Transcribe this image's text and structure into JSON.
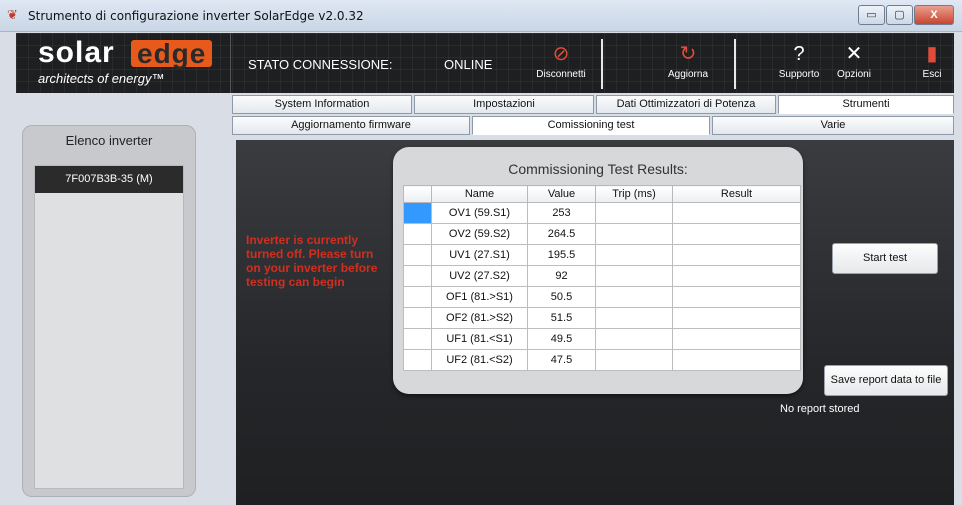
{
  "window": {
    "title": "Strumento di configurazione inverter SolarEdge v2.0.32",
    "controls": {
      "minimize": "▭",
      "maximize": "▢",
      "close": "X"
    }
  },
  "header": {
    "logo_solar": "solar",
    "logo_edge": "edge",
    "logo_tagline": "architects of energy™",
    "connection_label": "STATO CONNESSIONE:",
    "connection_status": "ONLINE",
    "buttons": [
      {
        "label": "Disconnetti",
        "icon": "unlink-icon"
      },
      {
        "label": "Aggiorna",
        "icon": "refresh-icon"
      },
      {
        "label": "Supporto",
        "icon": "help-icon"
      },
      {
        "label": "Opzioni",
        "icon": "tools-icon"
      },
      {
        "label": "Esci",
        "icon": "exit-door-icon"
      }
    ],
    "colors": {
      "background": "#1e1f21",
      "accent": "#e85a1c",
      "icon_red": "#e24a3a"
    }
  },
  "tabs_top": [
    "System Information",
    "Impostazioni",
    "Dati Ottimizzatori di Potenza",
    "Strumenti"
  ],
  "tabs_top_selected": "Strumenti",
  "tabs_sub": [
    "Aggiornamento firmware",
    "Comissioning test",
    "Varie"
  ],
  "tabs_sub_selected": "Comissioning test",
  "sidebar": {
    "title": "Elenco inverter",
    "items": [
      "7F007B3B-35 (M)"
    ]
  },
  "main": {
    "warning": "Inverter is currently turned off. Please turn on your inverter before testing can begin",
    "results_title": "Commissioning Test Results:",
    "columns": [
      "Name",
      "Value",
      "Trip (ms)",
      "Result"
    ],
    "rows": [
      {
        "name": "OV1 (59.S1)",
        "value": "253",
        "trip": "",
        "result": ""
      },
      {
        "name": "OV2 (59.S2)",
        "value": "264.5",
        "trip": "",
        "result": ""
      },
      {
        "name": "UV1 (27.S1)",
        "value": "195.5",
        "trip": "",
        "result": ""
      },
      {
        "name": "UV2 (27.S2)",
        "value": "92",
        "trip": "",
        "result": ""
      },
      {
        "name": "OF1 (81.>S1)",
        "value": "50.5",
        "trip": "",
        "result": ""
      },
      {
        "name": "OF2 (81.>S2)",
        "value": "51.5",
        "trip": "",
        "result": ""
      },
      {
        "name": "UF1 (81.<S1)",
        "value": "49.5",
        "trip": "",
        "result": ""
      },
      {
        "name": "UF2 (81.<S2)",
        "value": "47.5",
        "trip": "",
        "result": ""
      }
    ],
    "start_button": "Start test",
    "save_button": "Save report data to file",
    "report_status": "No report stored",
    "warning_color": "#d12f1f"
  }
}
